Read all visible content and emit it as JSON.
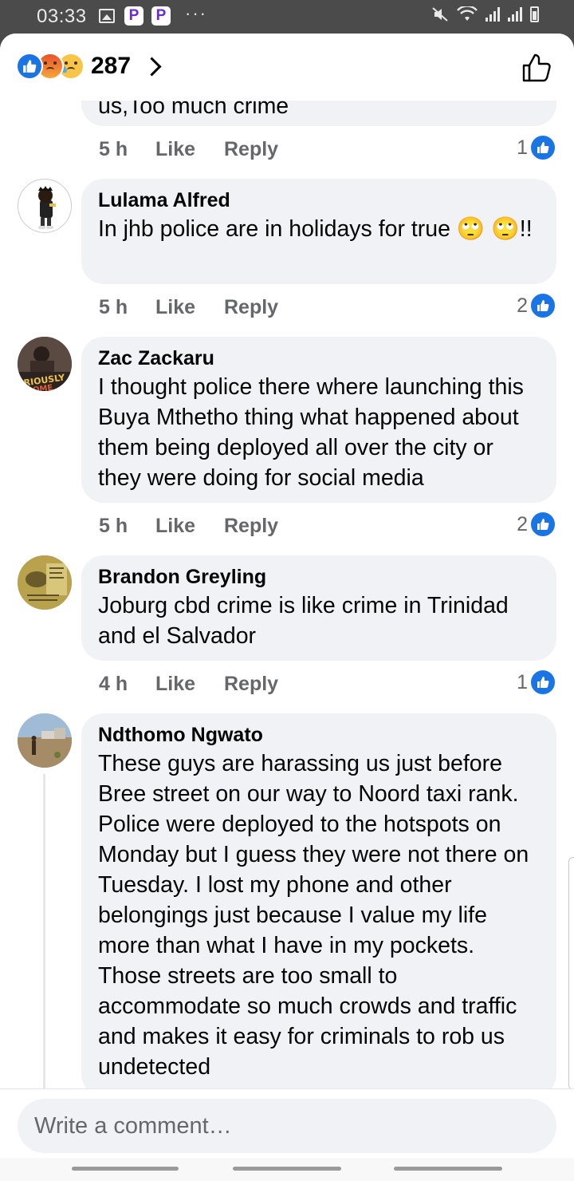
{
  "status_bar": {
    "time": "03:33",
    "icons": [
      "gallery-icon",
      "pocket-p-icon",
      "pocket-p-icon",
      "more-dots-icon",
      "mute-icon",
      "wifi-icon",
      "signal-icon",
      "signal-icon",
      "battery-icon"
    ],
    "dots": "···"
  },
  "header": {
    "reactions": [
      "like",
      "angry",
      "sad"
    ],
    "reaction_count": "287",
    "colors": {
      "like_blue": "#1b74e4",
      "angry": "#e9512a",
      "sad": "#f7c548"
    }
  },
  "comments": [
    {
      "partial": true,
      "text": "us,Too much crime",
      "time": "5 h",
      "like_label": "Like",
      "reply_label": "Reply",
      "like_count": "1"
    },
    {
      "name": "Lulama Alfred",
      "text": "In jhb police are in holidays for true 🙄 🙄!!",
      "time": "5 h",
      "like_label": "Like",
      "reply_label": "Reply",
      "like_count": "2"
    },
    {
      "name": "Zac Zackaru",
      "text": "I thought police there where launching this Buya Mthetho thing what happened about them being deployed all over the city or they were doing for social media",
      "time": "5 h",
      "like_label": "Like",
      "reply_label": "Reply",
      "like_count": "2"
    },
    {
      "name": "Brandon Greyling",
      "text": "Joburg cbd crime is like crime in Trinidad and el Salvador",
      "time": "4 h",
      "like_label": "Like",
      "reply_label": "Reply",
      "like_count": "1"
    },
    {
      "name": "Ndthomo Ngwato",
      "text": "These guys are harassing us just before Bree street on our way to Noord taxi rank. Police were deployed to the hotspots on Monday but I guess they were not there on Tuesday. I lost my phone and other belongings just because I value my life more than what I have in my pockets. Those streets are too small to accommodate so much crowds and traffic and makes it easy for criminals to rob us undetected"
    }
  ],
  "composer": {
    "placeholder": "Write a comment…"
  }
}
